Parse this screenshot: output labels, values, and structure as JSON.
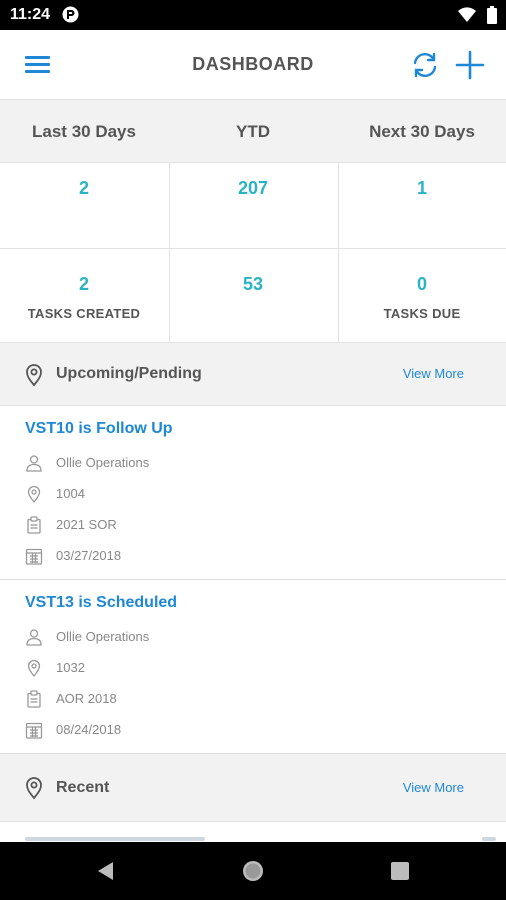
{
  "status_bar": {
    "time": "11:24",
    "icons": [
      "app-notification-icon",
      "wifi-icon",
      "battery-icon"
    ]
  },
  "app_bar": {
    "title": "DASHBOARD",
    "menu_icon": "hamburger-menu-icon",
    "refresh_icon": "refresh-icon",
    "add_icon": "plus-icon",
    "accent_color": "#1e88d7"
  },
  "periods": [
    "Last 30 Days",
    "YTD",
    "Next 30 Days"
  ],
  "stats": {
    "value_color": "#29b3c5",
    "row1": [
      {
        "value": "2",
        "label": ""
      },
      {
        "value": "207",
        "label": ""
      },
      {
        "value": "1",
        "label": ""
      }
    ],
    "row2": [
      {
        "value": "2",
        "label": "TASKS CREATED"
      },
      {
        "value": "53",
        "label": ""
      },
      {
        "value": "0",
        "label": "TASKS DUE"
      }
    ]
  },
  "upcoming": {
    "title": "Upcoming/Pending",
    "view_more": "View More",
    "icon": "location-pin-icon",
    "items": [
      {
        "title": "VST10 is Follow Up",
        "person": "Ollie Operations",
        "location": "1004",
        "project": "2021 SOR",
        "date": "03/27/2018"
      },
      {
        "title": "VST13 is Scheduled",
        "person": "Ollie Operations",
        "location": "1032",
        "project": "AOR 2018",
        "date": "08/24/2018"
      }
    ]
  },
  "recent": {
    "title": "Recent",
    "view_more": "View More",
    "icon": "location-pin-icon"
  },
  "nav_bar": {
    "buttons": [
      "back-icon",
      "home-icon",
      "recents-icon"
    ]
  }
}
